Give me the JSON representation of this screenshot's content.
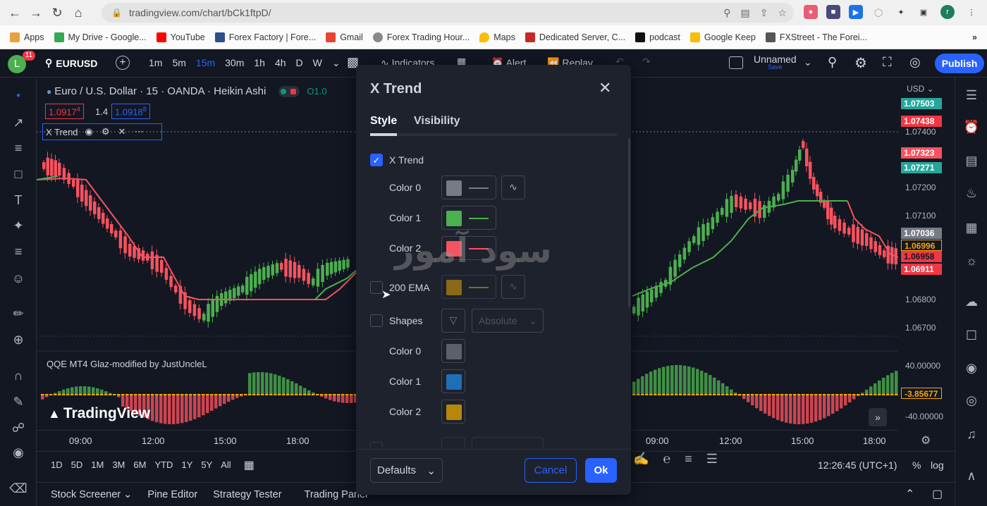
{
  "browser": {
    "url": "tradingview.com/chart/bCk1ftpD/",
    "profile_initial": "r",
    "bookmarks": [
      "Apps",
      "My Drive - Google...",
      "YouTube",
      "Forex Factory | Fore...",
      "Gmail",
      "Forex Trading Hour...",
      "Maps",
      "Dedicated Server, C...",
      "podcast",
      "Google Keep",
      "FXStreet - The Forei..."
    ]
  },
  "toolbar": {
    "avatar": "L",
    "badge": "11",
    "symbol": "EURUSD",
    "timeframes": [
      "1m",
      "5m",
      "15m",
      "30m",
      "1h",
      "4h",
      "D",
      "W"
    ],
    "active_timeframe": "15m",
    "indicators": "Indicators",
    "alert": "Alert",
    "replay": "Replay",
    "layout_name": "Unnamed",
    "layout_sub": "Save",
    "publish": "Publish"
  },
  "legend": {
    "title": "Euro / U.S. Dollar · 15 · OANDA · Heikin Ashi",
    "o_prefix": "O1.0",
    "bid": "1.0917",
    "bid_sup": "4",
    "spread": "1.4",
    "ask": "1.0918",
    "ask_sup": "8",
    "indicator": "X Trend",
    "qqe": "QQE MT4 Glaz-modified by JustUncleL",
    "watermark": "TradingView"
  },
  "price_axis": {
    "currency": "USD",
    "labels": [
      "1.07400",
      "1.07200",
      "1.07100",
      "1.06800",
      "1.06700",
      "40.00000",
      "-40.00000"
    ],
    "tags": [
      {
        "v": "1.07503",
        "c": "#26a69a"
      },
      {
        "v": "1.07438",
        "c": "#f23645"
      },
      {
        "v": "1.07323",
        "c": "#f7525f"
      },
      {
        "v": "1.07271",
        "c": "#26a69a"
      },
      {
        "v": "1.07036",
        "c": "#787b86"
      },
      {
        "v": "1.06996",
        "c": "#131722"
      },
      {
        "v": "1.06958",
        "c": "#f23645"
      },
      {
        "v": "1.06911",
        "c": "#f23645"
      },
      {
        "v": "-3.85677",
        "c": "#131722"
      }
    ]
  },
  "time_axis": [
    "09:00",
    "12:00",
    "15:00",
    "18:00",
    "09:00",
    "12:00",
    "15:00",
    "18:00"
  ],
  "ranges": [
    "1D",
    "5D",
    "1M",
    "3M",
    "6M",
    "YTD",
    "1Y",
    "5Y",
    "All"
  ],
  "clock": "12:26:45 (UTC+1)",
  "pct": "%",
  "log": "log",
  "bottom_tabs": [
    "Stock Screener",
    "Pine Editor",
    "Strategy Tester",
    "Trading Panel"
  ],
  "dialog": {
    "title": "X Trend",
    "tabs": [
      "Style",
      "Visibility"
    ],
    "rows": {
      "xtrend": "X Trend",
      "color0": "Color 0",
      "color1": "Color 1",
      "color2": "Color 2",
      "ema": "200 EMA",
      "shapes": "Shapes",
      "absolute": "Absolute",
      "s_color0": "Color 0",
      "s_color1": "Color 1",
      "s_color2": "Color 2"
    },
    "defaults": "Defaults",
    "cancel": "Cancel",
    "ok": "Ok",
    "watermark_text": "سود آموز"
  },
  "colors": {
    "accent": "#2962ff",
    "green": "#4caf50",
    "red": "#f7525f",
    "orange": "#b8860b",
    "blue": "#1e6fb7",
    "grey": "#5d606b"
  }
}
